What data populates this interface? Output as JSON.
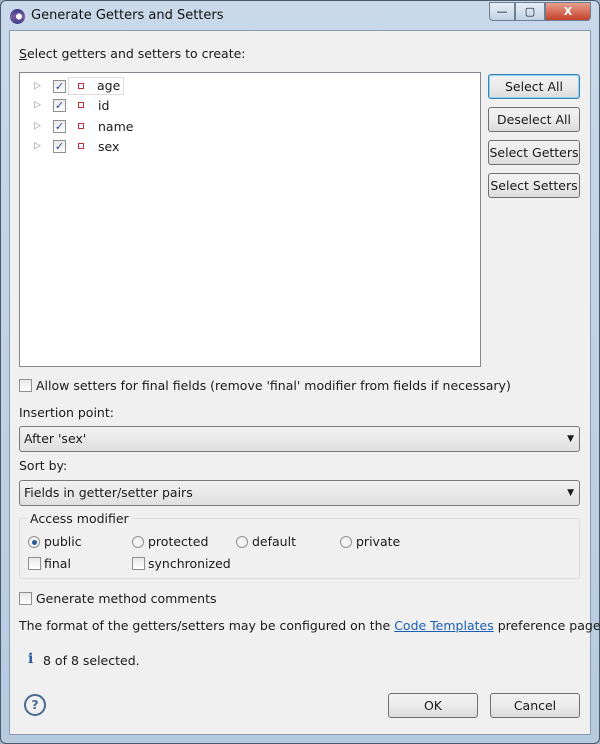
{
  "window": {
    "title": "Generate Getters and Setters",
    "minimize": "—",
    "maximize": "▢",
    "close": "X"
  },
  "tree": {
    "label": "Select getters and setters to create:",
    "items": [
      {
        "name": "age",
        "checked": true
      },
      {
        "name": "id",
        "checked": true
      },
      {
        "name": "name",
        "checked": true
      },
      {
        "name": "sex",
        "checked": true
      }
    ]
  },
  "buttons": {
    "select_all": "Select All",
    "deselect_all": "Deselect All",
    "select_getters": "Select Getters",
    "select_setters": "Select Setters"
  },
  "allow_setters": {
    "label": "Allow setters for final fields (remove 'final' modifier from fields if necessary)",
    "checked": false
  },
  "insertion": {
    "label": "Insertion point:",
    "value": "After 'sex'"
  },
  "sort": {
    "label": "Sort by:",
    "value": "Fields in getter/setter pairs"
  },
  "access": {
    "title": "Access modifier",
    "radios": [
      "public",
      "protected",
      "default",
      "private"
    ],
    "selected": "public",
    "final": "final",
    "synchronized": "synchronized"
  },
  "comments": {
    "label": "Generate method comments",
    "checked": false
  },
  "info": {
    "prefix": "The format of the getters/setters may be configured on the ",
    "link": "Code Templates",
    "suffix": " preference page."
  },
  "status": {
    "icon": "i",
    "text": "8 of 8 selected."
  },
  "footer": {
    "ok": "OK",
    "cancel": "Cancel",
    "help": "?"
  }
}
